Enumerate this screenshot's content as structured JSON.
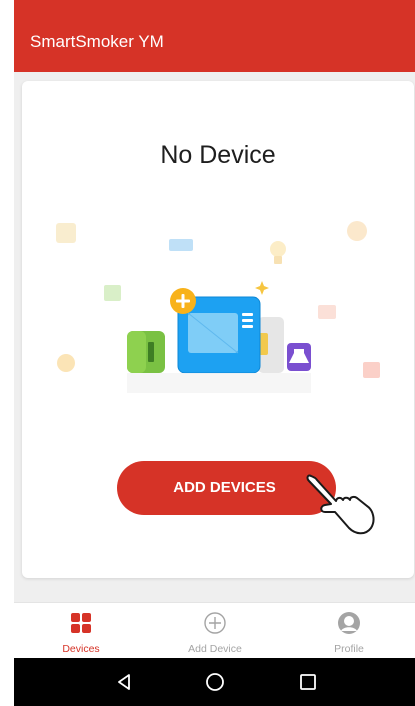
{
  "appbar": {
    "title": "SmartSmoker YM"
  },
  "empty_state": {
    "title": "No Device"
  },
  "primary_action": {
    "label": "ADD DEVICES"
  },
  "bottom_nav": {
    "items": [
      {
        "label": "Devices",
        "icon": "grid-icon",
        "active": true
      },
      {
        "label": "Add Device",
        "icon": "plus-circle-icon",
        "active": false
      },
      {
        "label": "Profile",
        "icon": "user-icon",
        "active": false
      }
    ]
  },
  "system_nav": {
    "buttons": [
      {
        "icon": "back-icon"
      },
      {
        "icon": "home-icon"
      },
      {
        "icon": "recents-icon"
      }
    ]
  },
  "colors": {
    "accent": "#d63327",
    "inactive": "#a4a4a4",
    "background": "#efefef"
  }
}
